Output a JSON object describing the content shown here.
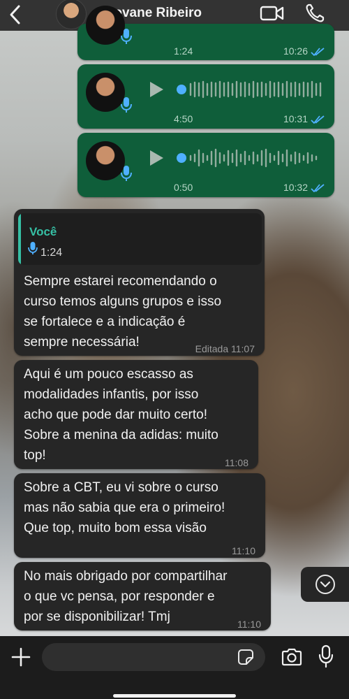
{
  "header": {
    "contact_name": "Geovane Ribeiro",
    "icons": [
      "back-chevron-icon",
      "video-call-icon",
      "phone-icon"
    ]
  },
  "voice_messages": [
    {
      "duration": "1:24",
      "time": "10:26",
      "status": "read"
    },
    {
      "duration": "4:50",
      "time": "10:31",
      "status": "read"
    },
    {
      "duration": "0:50",
      "time": "10:32",
      "status": "read"
    }
  ],
  "messages": [
    {
      "quote": {
        "author": "Você",
        "duration": "1:24"
      },
      "text": "Sempre estarei recomendando o\ncurso temos alguns grupos e isso\nse fortalece e a indicação é\nsempre necessária!",
      "time": "Editada 11:07"
    },
    {
      "text": "Aqui é um pouco escasso as\nmodalidades infantis, por isso\nacho que pode dar muito certo!\nSobre a menina da adidas: muito\ntop!",
      "time": "11:08"
    },
    {
      "text": "Sobre a CBT, eu vi sobre o curso\nmas não sabia que era o primeiro!\nQue top, muito bom essa visão",
      "time": "11:10"
    },
    {
      "text": "No mais obrigado por compartilhar\no que vc pensa, por responder e\npor se disponibilizar! Tmj",
      "time": "11:10"
    }
  ],
  "composer": {
    "placeholder": ""
  },
  "colors": {
    "outgoing_bubble": "#0f5e3a",
    "incoming_bubble": "#262626",
    "quote_accent": "#36c0a5",
    "read_ticks": "#4fb0ff"
  }
}
